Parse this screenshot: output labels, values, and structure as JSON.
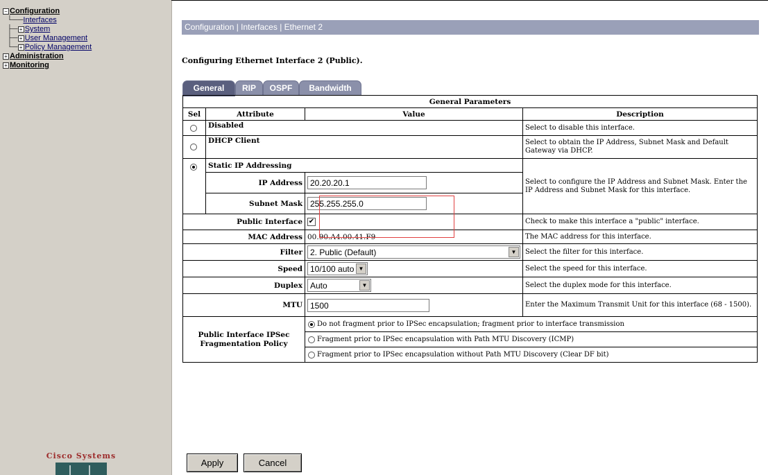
{
  "sidebar": {
    "tree": [
      {
        "label": "Configuration",
        "prefix": "⊟",
        "level": 0
      },
      {
        "label": "Interfaces",
        "prefix": "",
        "level": 1
      },
      {
        "label": "System",
        "prefix": "⊞",
        "level": 1
      },
      {
        "label": "User Management",
        "prefix": "⊞",
        "level": 1
      },
      {
        "label": "Policy Management",
        "prefix": "⊞",
        "level": 1
      },
      {
        "label": "Administration",
        "prefix": "⊞",
        "level": 0
      },
      {
        "label": "Monitoring",
        "prefix": "⊞",
        "level": 0
      }
    ],
    "logo_text": "Cisco Systems"
  },
  "header": {
    "breadcrumb": "Configuration | Interfaces | Ethernet 2",
    "subtitle": "Configuring Ethernet Interface 2 (Public)."
  },
  "tabs": [
    "General",
    "RIP",
    "OSPF",
    "Bandwidth"
  ],
  "table": {
    "caption": "General Parameters",
    "headers": {
      "sel": "Sel",
      "attribute": "Attribute",
      "value": "Value",
      "description": "Description"
    },
    "disabled": {
      "label": "Disabled",
      "desc": "Select to disable this interface."
    },
    "dhcp": {
      "label": "DHCP Client",
      "desc": "Select to obtain the IP Address, Subnet Mask and Default Gateway via DHCP."
    },
    "static": {
      "label": "Static IP Addressing",
      "desc": "Select to configure the IP Address and Subnet Mask. Enter the IP Address and Subnet Mask for this interface.",
      "ip_label": "IP Address",
      "ip_value": "20.20.20.1",
      "mask_label": "Subnet Mask",
      "mask_value": "255.255.255.0"
    },
    "public": {
      "label": "Public Interface",
      "check": "✔",
      "desc": "Check to make this interface a \"public\" interface."
    },
    "mac": {
      "label": "MAC Address",
      "value": "00.90.A4.00.41.F9",
      "desc": "The MAC address for this interface."
    },
    "filter": {
      "label": "Filter",
      "value": "2. Public (Default)",
      "desc": "Select the filter for this interface."
    },
    "speed": {
      "label": "Speed",
      "value": "10/100 auto",
      "desc": "Select the speed for this interface."
    },
    "duplex": {
      "label": "Duplex",
      "value": "Auto",
      "desc": "Select the duplex mode for this interface."
    },
    "mtu": {
      "label": "MTU",
      "value": "1500",
      "desc": "Enter the Maximum Transmit Unit for this interface (68 - 1500)."
    },
    "frag": {
      "label": "Public Interface IPSec Fragmentation Policy",
      "options": [
        "Do not fragment prior to IPSec encapsulation; fragment prior to interface transmission",
        "Fragment prior to IPSec encapsulation with Path MTU Discovery (ICMP)",
        "Fragment prior to IPSec encapsulation without Path MTU Discovery (Clear DF bit)"
      ]
    }
  },
  "buttons": {
    "apply": "Apply",
    "cancel": "Cancel"
  },
  "icons": {
    "dropdown": "▼"
  }
}
